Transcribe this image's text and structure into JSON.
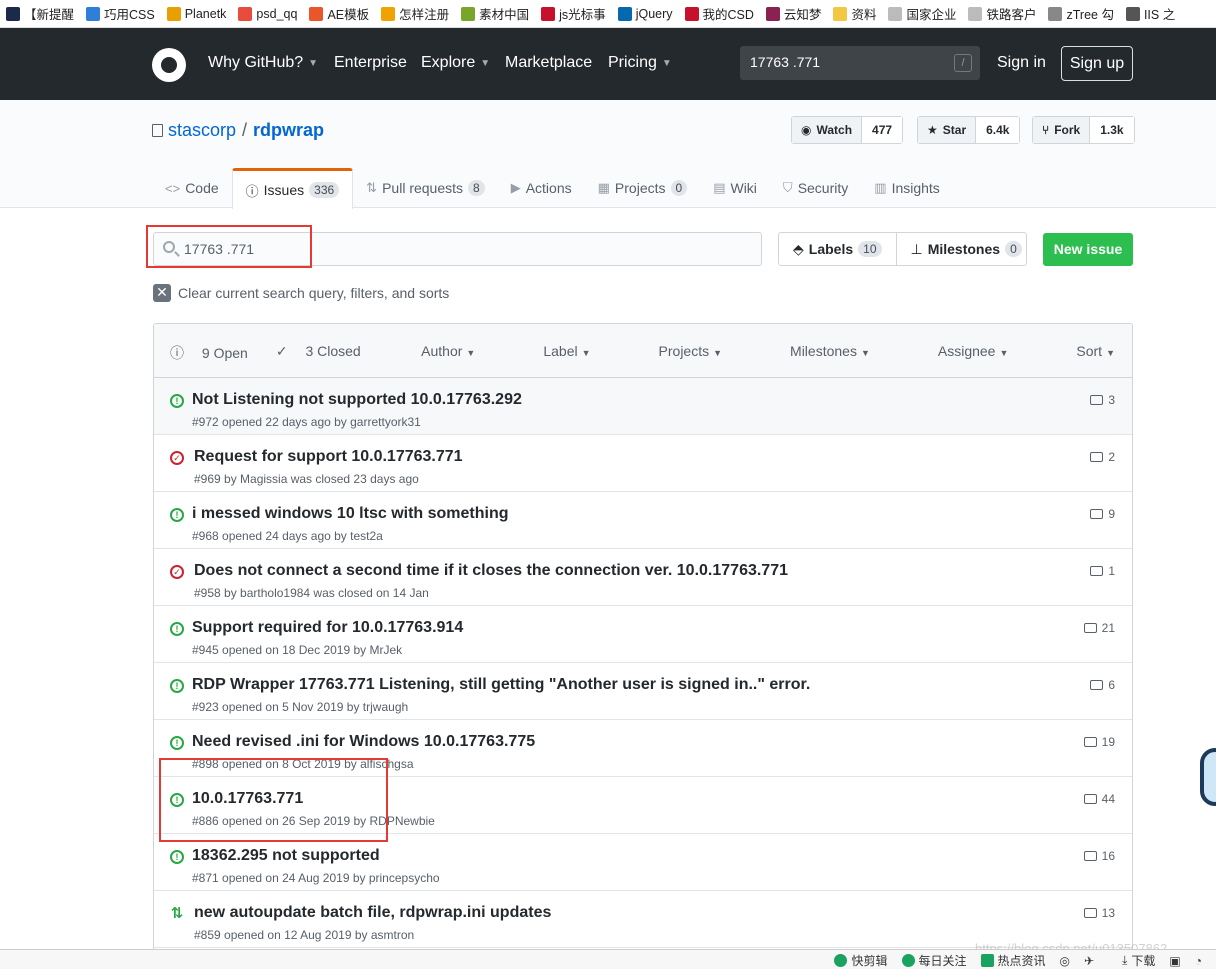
{
  "bookmarks": [
    {
      "label": "【新提醒",
      "color": "#1b2a4a"
    },
    {
      "label": "巧用CSS",
      "color": "#2f7fd8"
    },
    {
      "label": "Planetk",
      "color": "#e8a000"
    },
    {
      "label": "psd_qq",
      "color": "#e84c3d"
    },
    {
      "label": "AE模板",
      "color": "#e8562a"
    },
    {
      "label": "怎样注册",
      "color": "#f0a300"
    },
    {
      "label": "素材中国",
      "color": "#7aa52b"
    },
    {
      "label": "js光标事",
      "color": "#c8102e"
    },
    {
      "label": "jQuery",
      "color": "#0769ad"
    },
    {
      "label": "我的CSD",
      "color": "#c8102e"
    },
    {
      "label": "云知梦",
      "color": "#8b2052"
    },
    {
      "label": "资料",
      "color": "#f2c744"
    },
    {
      "label": "国家企业",
      "color": "#bbbbbb"
    },
    {
      "label": "铁路客户",
      "color": "#bbbbbb"
    },
    {
      "label": "zTree 勾",
      "color": "#888888"
    },
    {
      "label": "IIS 之",
      "color": "#555555"
    }
  ],
  "header": {
    "nav": [
      {
        "label": "Why GitHub?",
        "caret": true
      },
      {
        "label": "Enterprise",
        "caret": false
      },
      {
        "label": "Explore",
        "caret": true
      },
      {
        "label": "Marketplace",
        "caret": false
      },
      {
        "label": "Pricing",
        "caret": true
      }
    ],
    "search_value": "17763 .771",
    "search_shortcut": "/",
    "signin": "Sign in",
    "signup": "Sign up"
  },
  "repo": {
    "owner": "stascorp",
    "separator": "/",
    "name": "rdpwrap",
    "watch": {
      "label": "Watch",
      "count": "477"
    },
    "star": {
      "label": "Star",
      "count": "6.4k"
    },
    "fork": {
      "label": "Fork",
      "count": "1.3k"
    }
  },
  "tabs": [
    {
      "label": "Code",
      "icon": "<>",
      "count": ""
    },
    {
      "label": "Issues",
      "icon": "!",
      "count": "336"
    },
    {
      "label": "Pull requests",
      "icon": "⇅",
      "count": "8"
    },
    {
      "label": "Actions",
      "icon": "▶",
      "count": ""
    },
    {
      "label": "Projects",
      "icon": "▦",
      "count": "0"
    },
    {
      "label": "Wiki",
      "icon": "▤",
      "count": ""
    },
    {
      "label": "Security",
      "icon": "⛉",
      "count": ""
    },
    {
      "label": "Insights",
      "icon": "▥",
      "count": ""
    }
  ],
  "filter": {
    "query": "17763 .771",
    "labels": "Labels",
    "labels_count": "10",
    "milestones": "Milestones",
    "milestones_count": "0",
    "new_issue": "New issue",
    "clear": "Clear current search query, filters, and sorts"
  },
  "list_header": {
    "open": "9 Open",
    "closed": "3 Closed",
    "filters": [
      "Author",
      "Label",
      "Projects",
      "Milestones",
      "Assignee",
      "Sort"
    ]
  },
  "issues": [
    {
      "title": "Not Listening not supported 10.0.17763.292",
      "meta": "#972 opened 22 days ago by garrettyork31",
      "comments": "3",
      "state": "open"
    },
    {
      "title": "Request for support 10.0.17763.771",
      "meta": "#969 by Magissia was closed 23 days ago",
      "comments": "2",
      "state": "closed"
    },
    {
      "title": "i messed windows 10 ltsc with something",
      "meta": "#968 opened 24 days ago by test2a",
      "comments": "9",
      "state": "open"
    },
    {
      "title": "Does not connect a second time if it closes the connection ver. 10.0.17763.771",
      "meta": "#958 by bartholo1984 was closed on 14 Jan",
      "comments": "1",
      "state": "closed"
    },
    {
      "title": "Support required for 10.0.17763.914",
      "meta": "#945 opened on 18 Dec 2019 by MrJek",
      "comments": "21",
      "state": "open"
    },
    {
      "title": "RDP Wrapper 17763.771 Listening, still getting \"Another user is signed in..\" error.",
      "meta": "#923 opened on 5 Nov 2019 by trjwaugh",
      "comments": "6",
      "state": "open"
    },
    {
      "title": "Need revised .ini for Windows 10.0.17763.775",
      "meta": "#898 opened on 8 Oct 2019 by alfischgsa",
      "comments": "19",
      "state": "open"
    },
    {
      "title": "10.0.17763.771",
      "meta": "#886 opened on 26 Sep 2019 by RDPNewbie",
      "comments": "44",
      "state": "open"
    },
    {
      "title": "18362.295 not supported",
      "meta": "#871 opened on 24 Aug 2019 by princepsycho",
      "comments": "16",
      "state": "open"
    },
    {
      "title": "new autoupdate batch file, rdpwrap.ini updates",
      "meta": "#859 opened on 12 Aug 2019 by asmtron",
      "comments": "13",
      "state": "pr"
    }
  ],
  "statusbar": {
    "items": [
      "快剪辑",
      "每日关注",
      "热点资讯",
      "下载"
    ],
    "watermark": "https://blog.csdn.net/u013507862"
  },
  "colors": {
    "header_bg": "#24292e",
    "accent_tab": "#e36209",
    "new_issue": "#2cbe4e",
    "open": "#28a745",
    "closed": "#cb2431",
    "link": "#0366d6"
  }
}
